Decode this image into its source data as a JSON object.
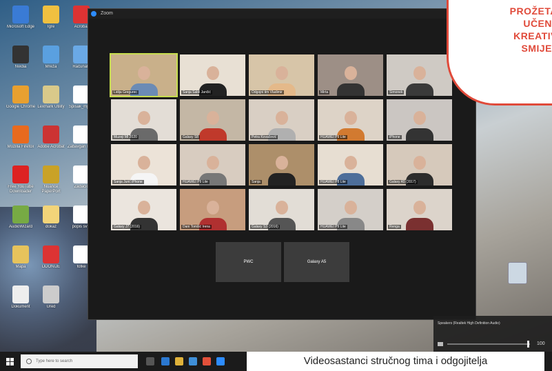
{
  "zoom_window": {
    "title": "Zoom"
  },
  "participants": [
    {
      "name": "Lidija Gregurec"
    },
    {
      "name": "Sanja Sabli Jančić"
    },
    {
      "name": "Odgojni tim Vladimir"
    },
    {
      "name": "Mirta"
    },
    {
      "name": "Šimonek"
    },
    {
      "name": "Muzeji MI 2020"
    },
    {
      "name": "Galaxy S8"
    },
    {
      "name": "Petra Kovačević"
    },
    {
      "name": "HUAWEI P9 Lite"
    },
    {
      "name": "iPhone"
    },
    {
      "name": "Sanja Jurić iPhone"
    },
    {
      "name": "HUAWEI P9 Lite"
    },
    {
      "name": "Sanja"
    },
    {
      "name": "HUAWEI P8 Lite"
    },
    {
      "name": "Galaxy A5 (2017)"
    },
    {
      "name": "Galaxy J7 (2016)"
    },
    {
      "name": "Dani Tomšić Irena"
    },
    {
      "name": "Galaxy S3 (2016)"
    },
    {
      "name": "HUAWEI P9 Lite"
    },
    {
      "name": "Renga"
    }
  ],
  "video_off_tiles": [
    {
      "name": "PWC"
    },
    {
      "name": "Galaxy A5"
    }
  ],
  "badge": {
    "lines": [
      "PROŽETA",
      "UČEN",
      "KREATIV",
      "SMIJE"
    ]
  },
  "speaker_panel": {
    "label": "Speakers (Realtek High Definition Audio)",
    "level": "100"
  },
  "taskbar": {
    "search_placeholder": "Type here to search"
  },
  "caption": "Videosastanci stručnog tima i odgojitelja",
  "desktop_icons": [
    {
      "label": "Microsoft Edge"
    },
    {
      "label": "Igre"
    },
    {
      "label": "Acrobat"
    },
    {
      "label": "Nvidia"
    },
    {
      "label": "Mreža"
    },
    {
      "label": "Računalo"
    },
    {
      "label": "Google Chrome"
    },
    {
      "label": "Lexmark Utility"
    },
    {
      "label": "Spisak_mjere"
    },
    {
      "label": "Mozilla Firefox"
    },
    {
      "label": "Adobe Acrobat"
    },
    {
      "label": "Zabavgan Plan"
    },
    {
      "label": "Free YouTube Downloader"
    },
    {
      "label": "Nuance PaperPort"
    },
    {
      "label": "Zadaćić"
    },
    {
      "label": "AudioWizard"
    },
    {
      "label": "dokaz"
    },
    {
      "label": "popis svih"
    },
    {
      "label": "Mapa"
    },
    {
      "label": "DDONIJE"
    },
    {
      "label": "fotke"
    },
    {
      "label": "Dokument"
    },
    {
      "label": "Ured"
    }
  ]
}
